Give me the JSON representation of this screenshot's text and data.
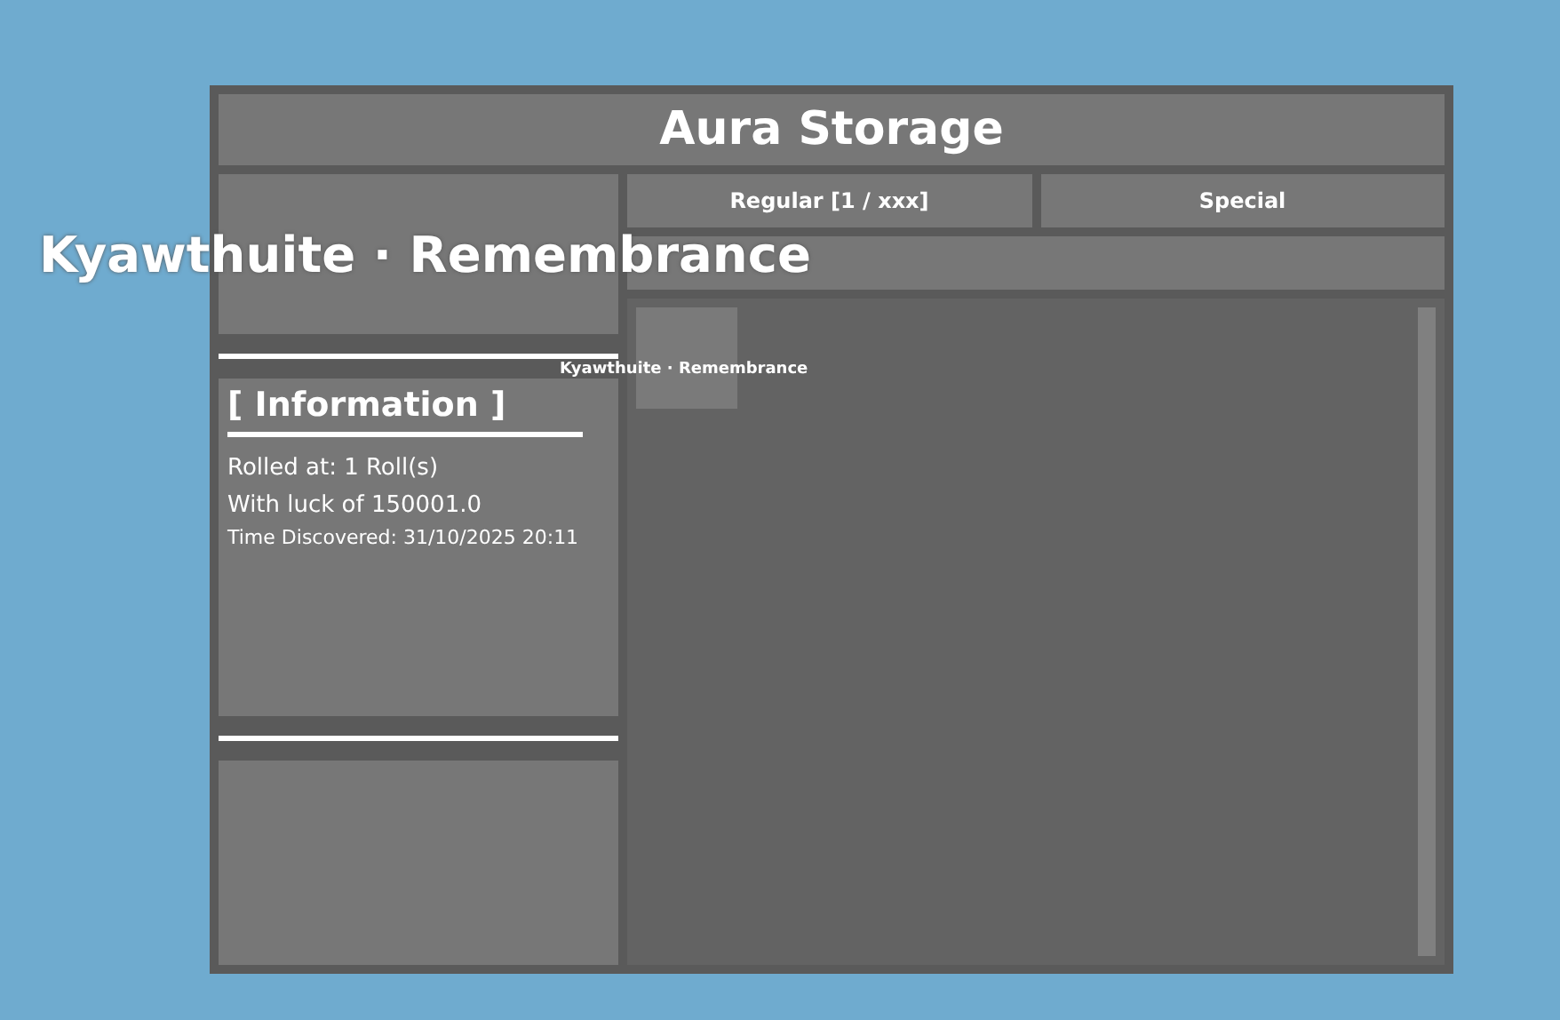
{
  "window": {
    "title": "Aura Storage"
  },
  "preview": {
    "name": "Kyawthuite · Remembrance"
  },
  "tabs": [
    {
      "label": "Regular [1 / xxx]"
    },
    {
      "label": "Special"
    }
  ],
  "information": {
    "heading": "[ Information ]",
    "rolled_at": "Rolled at: 1 Roll(s)",
    "luck": "With luck of 150001.0",
    "time_discovered": "Time Discovered: 31/10/2025 20:11"
  },
  "items": [
    {
      "label": "Kyawthuite · Remembrance"
    }
  ]
}
